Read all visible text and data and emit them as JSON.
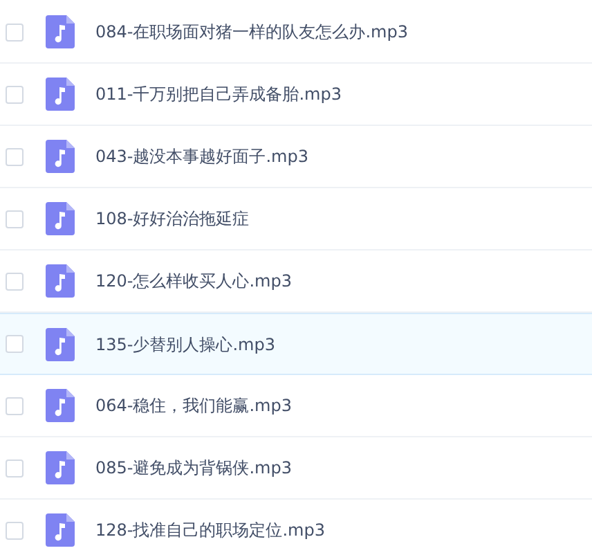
{
  "files": [
    {
      "name": "084-在职场面对猪一样的队友怎么办.mp3",
      "checked": false,
      "highlighted": false
    },
    {
      "name": "011-千万别把自己弄成备胎.mp3",
      "checked": false,
      "highlighted": false
    },
    {
      "name": "043-越没本事越好面子.mp3",
      "checked": false,
      "highlighted": false
    },
    {
      "name": "108-好好治治拖延症",
      "checked": false,
      "highlighted": false
    },
    {
      "name": "120-怎么样收买人心.mp3",
      "checked": false,
      "highlighted": false
    },
    {
      "name": "135-少替别人操心.mp3",
      "checked": false,
      "highlighted": true
    },
    {
      "name": "064-稳住，我们能赢.mp3",
      "checked": false,
      "highlighted": false
    },
    {
      "name": "085-避免成为背锅侠.mp3",
      "checked": false,
      "highlighted": false
    },
    {
      "name": "128-找准自己的职场定位.mp3",
      "checked": false,
      "highlighted": false
    }
  ]
}
